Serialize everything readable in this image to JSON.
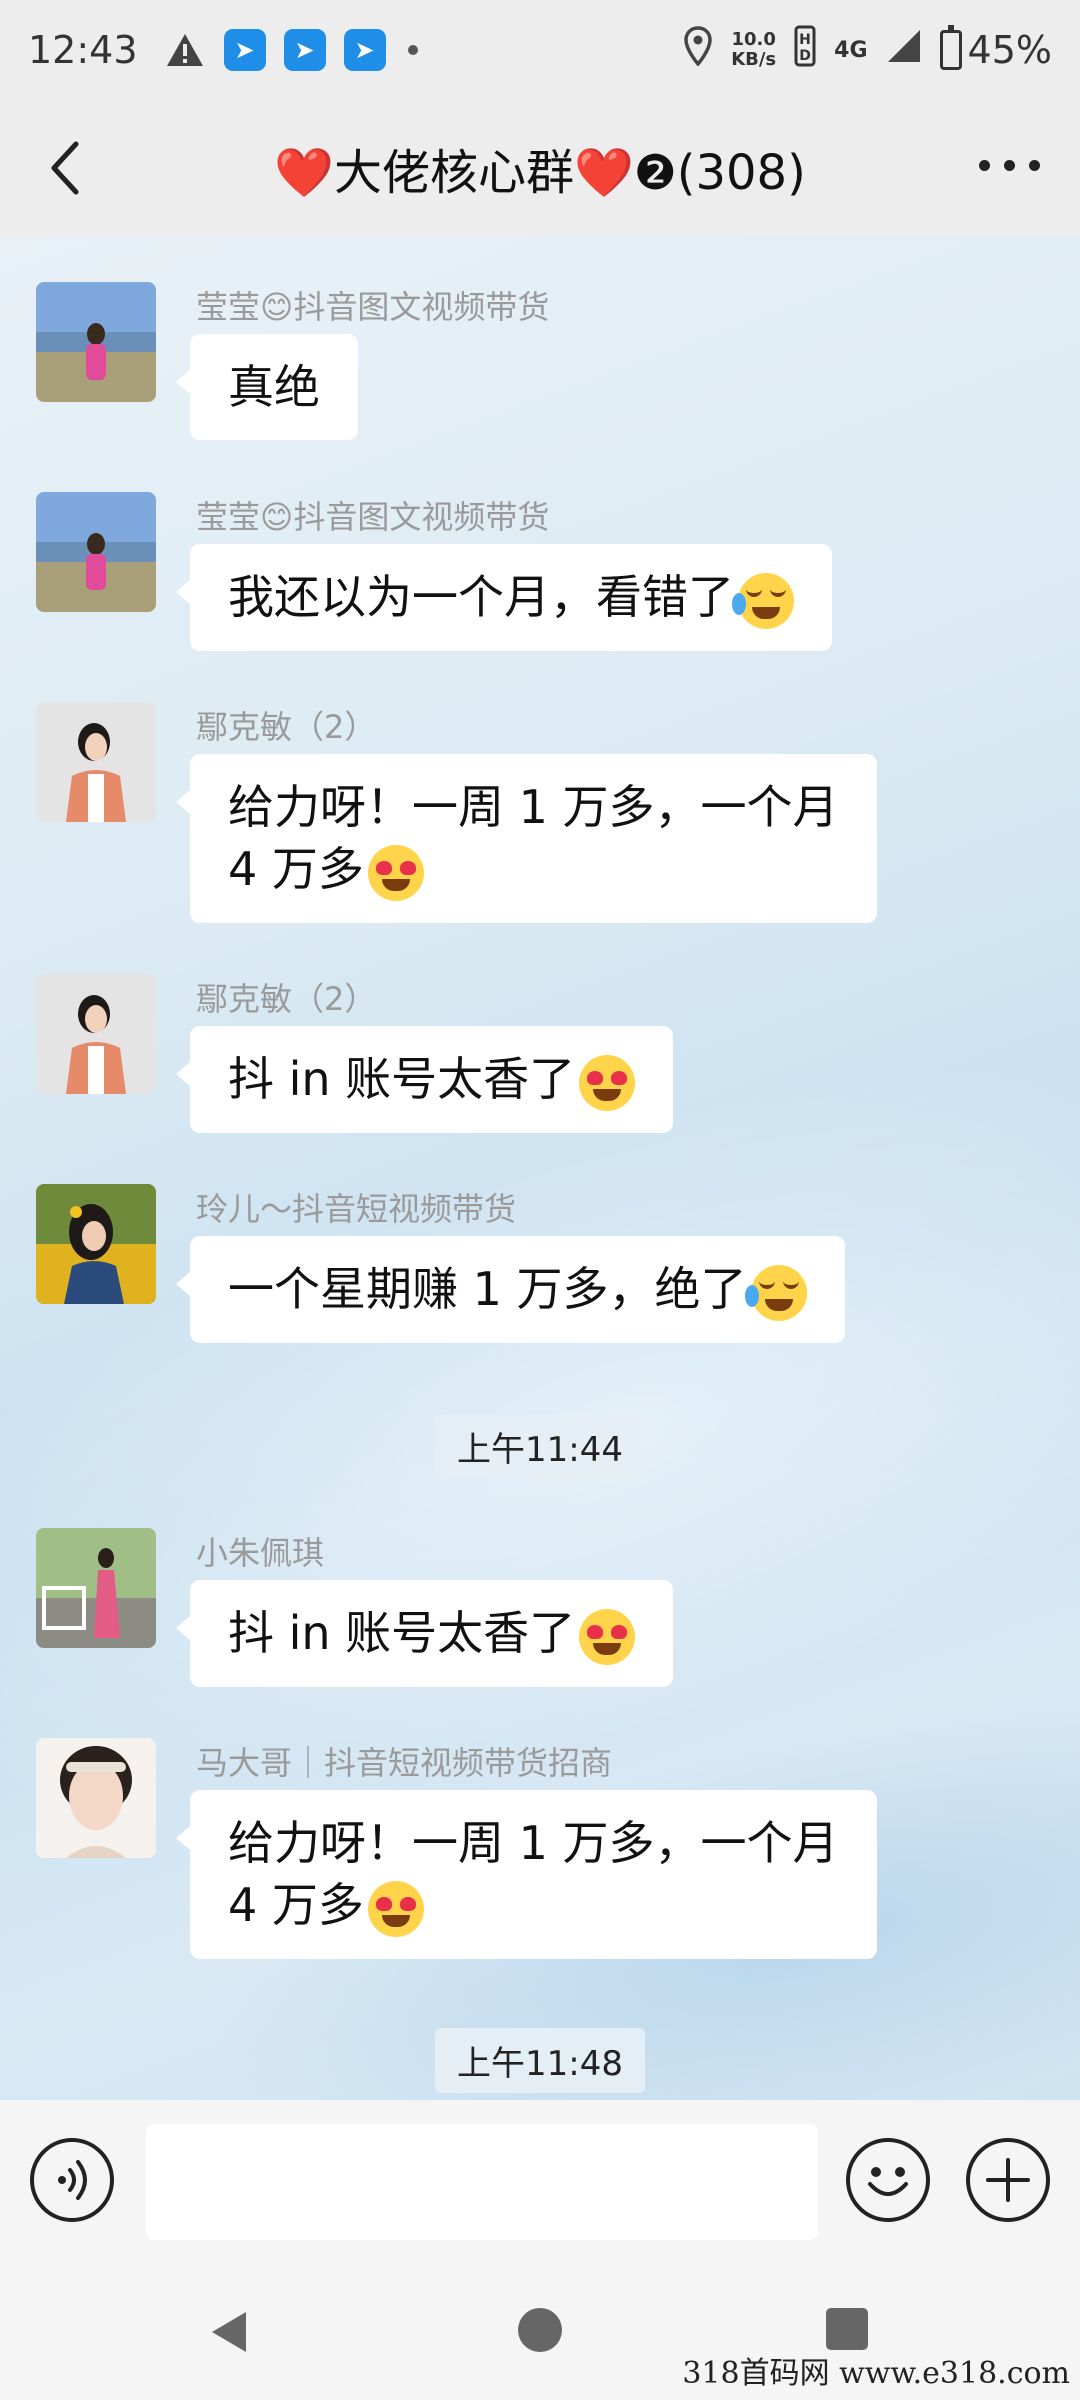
{
  "status_bar": {
    "time": "12:43",
    "speed_value": "10.0",
    "speed_unit": "KB/s",
    "network": "4G",
    "battery": "45%"
  },
  "header": {
    "title": "❤️大佬核心群❤️❷(308)"
  },
  "messages": [
    {
      "sender": "莹莹😊抖音图文视频带货",
      "text": "真绝",
      "emoji": null
    },
    {
      "sender": "莹莹😊抖音图文视频带货",
      "text": "我还以为一个月，看错了",
      "emoji": "crying-laughing"
    },
    {
      "sender": "鄢克敏（2）",
      "text_line1": "给力呀！一周 1 万多，一个月",
      "text_line2": "4 万多",
      "emoji": "heart-eyes"
    },
    {
      "sender": "鄢克敏（2）",
      "text": "抖 in 账号太香了",
      "emoji": "heart-eyes"
    },
    {
      "sender": "玲儿～抖音短视频带货",
      "text": "一个星期赚 1 万多，绝了",
      "emoji": "crying-laughing"
    },
    {
      "sender": "小朱佩琪",
      "text": "抖 in 账号太香了",
      "emoji": "heart-eyes"
    },
    {
      "sender": "马大哥｜抖音短视频带货招商",
      "text_line1": "给力呀！一周 1 万多，一个月",
      "text_line2": "4 万多",
      "emoji": "heart-eyes"
    }
  ],
  "timestamps": [
    "上午11:44",
    "上午11:48"
  ],
  "watermark": "318首码网  www.e318.com"
}
